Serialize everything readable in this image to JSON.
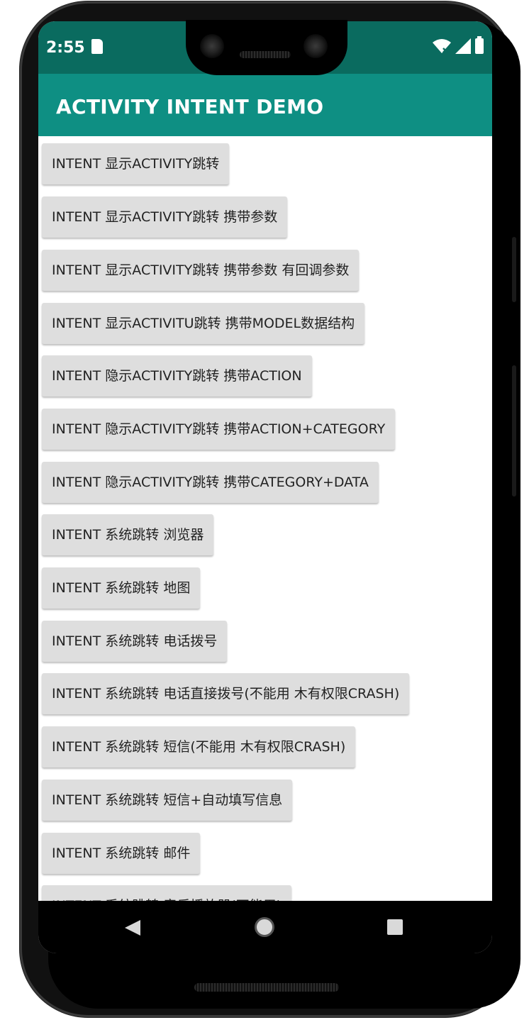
{
  "status_bar": {
    "time": "2:55",
    "icons": [
      "sd-card-icon",
      "wifi-icon",
      "signal-icon",
      "battery-icon"
    ]
  },
  "app_bar": {
    "title": "ACTIVITY INTENT DEMO",
    "color": "#0e8f83"
  },
  "buttons": [
    "INTENT 显示ACTIVITY跳转",
    "INTENT 显示ACTIVITY跳转 携带参数",
    "INTENT 显示ACTIVITY跳转 携带参数 有回调参数",
    "INTENT 显示ACTIVITU跳转 携带MODEL数据结构",
    "INTENT 隐示ACTIVITY跳转 携带ACTION",
    "INTENT 隐示ACTIVITY跳转 携带ACTION+CATEGORY",
    "INTENT 隐示ACTIVITY跳转 携带CATEGORY+DATA",
    "INTENT 系统跳转 浏览器",
    "INTENT 系统跳转 地图",
    "INTENT 系统跳转 电话拨号",
    "INTENT 系统跳转 电话直接拨号(不能用 木有权限CRASH)",
    "INTENT 系统跳转 短信(不能用 木有权限CRASH)",
    "INTENT 系统跳转 短信+自动填写信息",
    "INTENT 系统跳转 邮件",
    "INTENT 系统跳转 音乐播放器(不能用)"
  ],
  "nav_bar": {
    "icons": [
      "back-icon",
      "home-icon",
      "recents-icon"
    ]
  },
  "colors": {
    "status_bar": "#0a6b5f",
    "button_bg": "#dedede"
  }
}
